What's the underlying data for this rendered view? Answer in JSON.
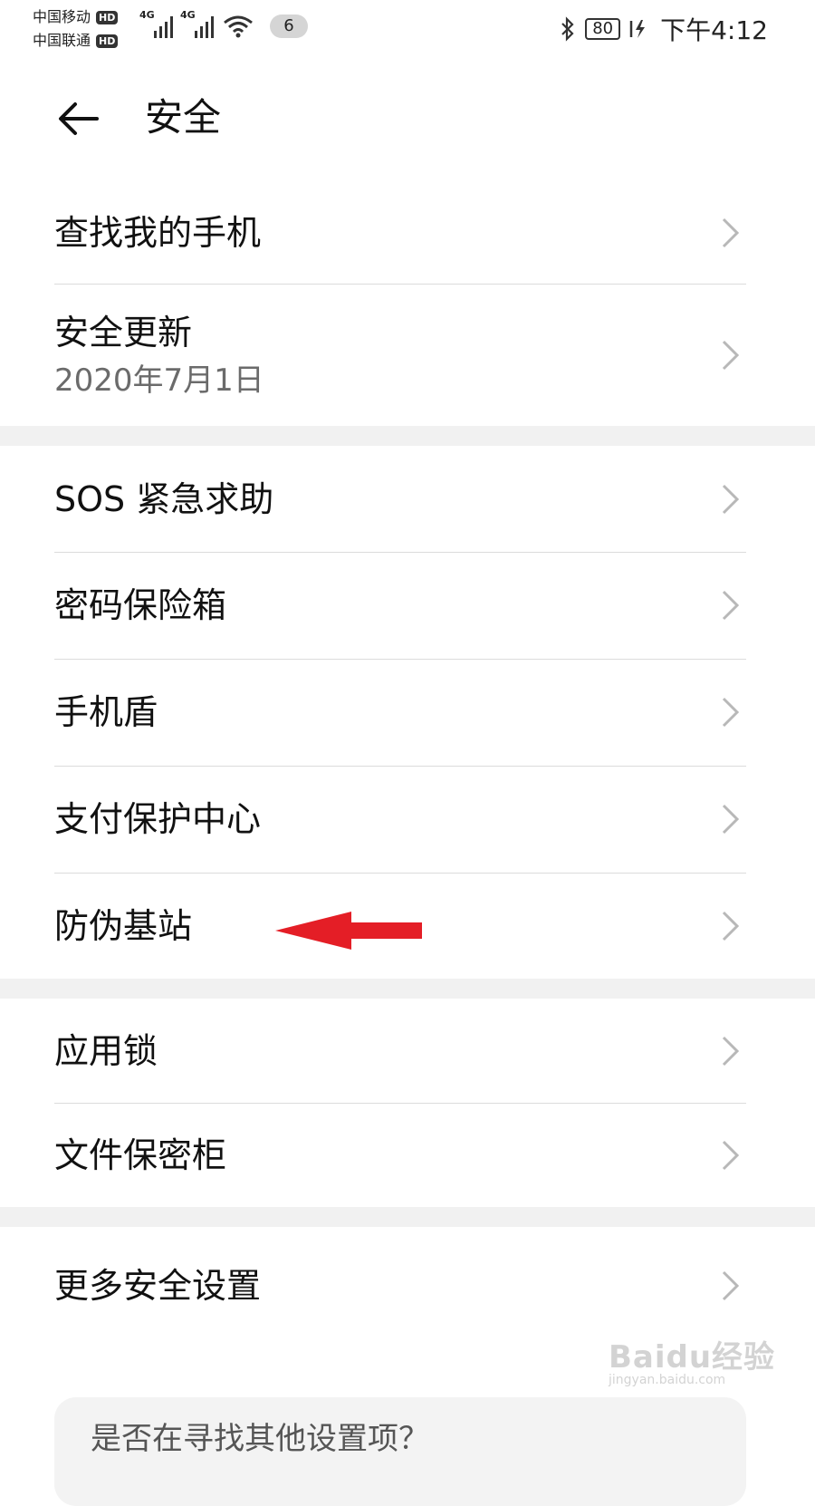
{
  "status_bar": {
    "carrier1": "中国移动",
    "carrier2": "中国联通",
    "hd": "HD",
    "net1": "4G",
    "net2": "4G",
    "notifications": "6",
    "battery": "80",
    "time": "下午4:12"
  },
  "header": {
    "title": "安全",
    "back_icon": "arrow-left-icon"
  },
  "groups": [
    {
      "items": [
        {
          "label": "查找我的手机"
        },
        {
          "label": "安全更新",
          "sub": "2020年7月1日"
        }
      ]
    },
    {
      "items": [
        {
          "label": "SOS 紧急求助"
        },
        {
          "label": "密码保险箱"
        },
        {
          "label": "手机盾"
        },
        {
          "label": "支付保护中心"
        },
        {
          "label": "防伪基站"
        }
      ]
    },
    {
      "items": [
        {
          "label": "应用锁"
        },
        {
          "label": "文件保密柜"
        }
      ]
    },
    {
      "items": [
        {
          "label": "更多安全设置"
        }
      ]
    }
  ],
  "bottom_card": {
    "text": "是否在寻找其他设置项？"
  },
  "watermark": {
    "logo": "Baidu经验",
    "url": "jingyan.baidu.com"
  },
  "colors": {
    "annotation_arrow": "#e41e26",
    "separator": "#f1f1f1",
    "chevron": "#b8b8b8"
  }
}
